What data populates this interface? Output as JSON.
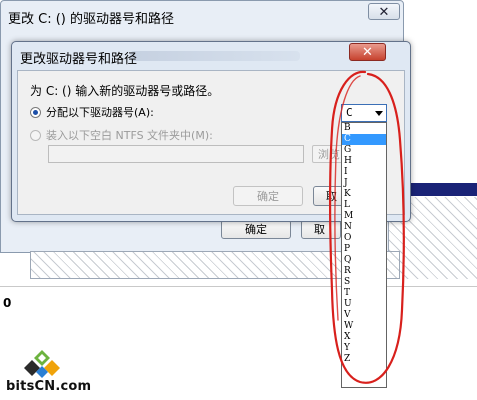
{
  "back_window": {
    "title": "更改 C: () 的驱动器号和路径",
    "close": "✕",
    "ok_label": "确定",
    "cancel_label": "取",
    "disk_label": "0"
  },
  "dialog": {
    "title": "更改驱动器号和路径",
    "close": "✕",
    "prompt": "为 C: () 输入新的驱动器号或路径。",
    "option_assign": "分配以下驱动器号(A):",
    "option_mount": "装入以下空白 NTFS 文件夹中(M):",
    "browse_label": "浏览",
    "ok_label": "确定",
    "cancel_label": "取",
    "selected_drive": "C",
    "drive_letters": [
      "B",
      "C",
      "G",
      "H",
      "I",
      "J",
      "K",
      "L",
      "M",
      "N",
      "O",
      "P",
      "Q",
      "R",
      "S",
      "T",
      "U",
      "V",
      "W",
      "X",
      "Y",
      "Z"
    ],
    "highlighted_drive": "C"
  },
  "logo": {
    "text": "bitsCN.com"
  },
  "colors": {
    "annotation": "#d8201c",
    "selection": "#3399ff",
    "close_button": "#c6422e"
  }
}
